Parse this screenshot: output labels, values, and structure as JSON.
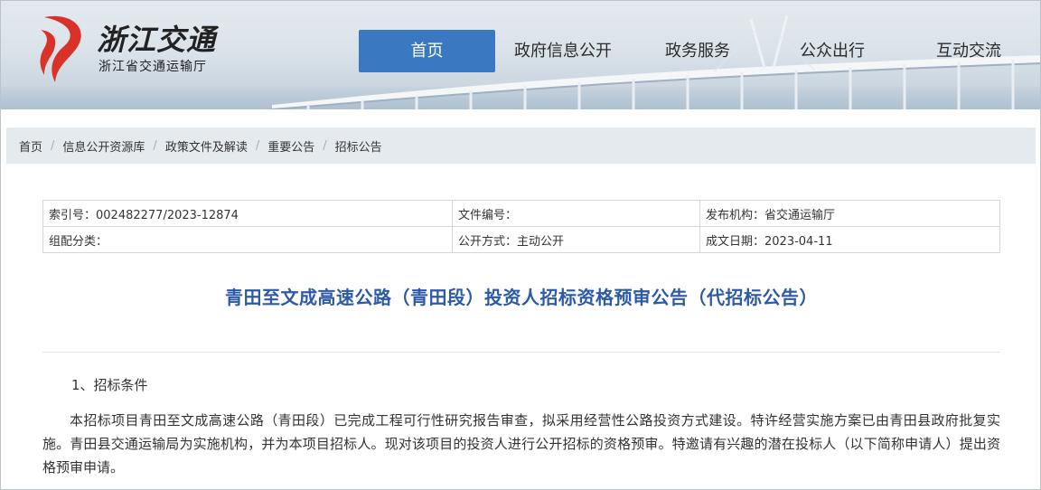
{
  "brand": {
    "logo_text": "浙江交通",
    "org_name": "浙江省交通运输厅"
  },
  "nav": {
    "items": [
      {
        "label": "首页",
        "active": true
      },
      {
        "label": "政府信息公开",
        "active": false
      },
      {
        "label": "政务服务",
        "active": false
      },
      {
        "label": "公众出行",
        "active": false
      },
      {
        "label": "互动交流",
        "active": false
      }
    ]
  },
  "breadcrumb": [
    "首页",
    "信息公开资源库",
    "政策文件及解读",
    "重要公告",
    "招标公告"
  ],
  "meta": {
    "index_no": "索引号：002482277/2023-12874",
    "doc_no": "文件编号：",
    "publisher": "发布机构：省交通运输厅",
    "category": "组配分类：",
    "open_mode": "公开方式：主动公开",
    "date": "成文日期：2023-04-11"
  },
  "article": {
    "title": "青田至文成高速公路（青田段）投资人招标资格预审公告（代招标公告）",
    "section_1": "1、招标条件",
    "paragraph_1": "本招标项目青田至文成高速公路（青田段）已完成工程可行性研究报告审查，拟采用经营性公路投资方式建设。特许经营实施方案已由青田县政府批复实施。青田县交通运输局为实施机构，并为本项目招标人。现对该项目的投资人进行公开招标的资格预审。特邀请有兴趣的潜在投标人（以下简称申请人）提出资格预审申请。"
  },
  "colors": {
    "accent": "#3a78c2",
    "title": "#2d5aa6",
    "logo_red": "#d8322b"
  }
}
